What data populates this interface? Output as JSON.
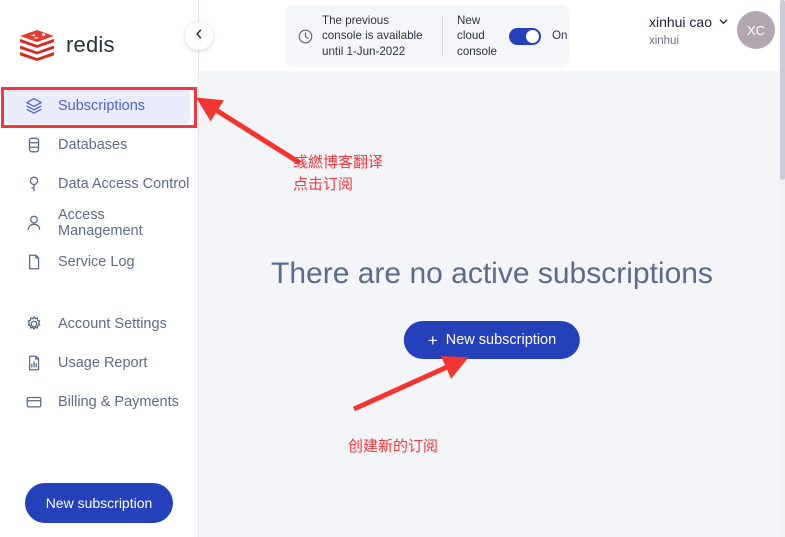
{
  "brand": {
    "name": "redis",
    "logo_icon": "redis-cube-logo"
  },
  "sidebar": {
    "collapse_icon": "chevron-left-icon",
    "groups": [
      {
        "items": [
          {
            "label": "Subscriptions",
            "icon": "layers-icon",
            "active": true
          },
          {
            "label": "Databases",
            "icon": "database-icon",
            "active": false
          },
          {
            "label": "Data Access Control",
            "icon": "key-icon",
            "active": false
          },
          {
            "label": "Access Management",
            "icon": "user-icon",
            "active": false
          },
          {
            "label": "Service Log",
            "icon": "document-icon",
            "active": false
          }
        ]
      },
      {
        "items": [
          {
            "label": "Account Settings",
            "icon": "gear-icon",
            "active": false
          },
          {
            "label": "Usage Report",
            "icon": "report-icon",
            "active": false
          },
          {
            "label": "Billing & Payments",
            "icon": "credit-card-icon",
            "active": false
          }
        ]
      }
    ],
    "cta_label": "New subscription"
  },
  "header": {
    "banner": {
      "icon": "clock-icon",
      "message": "The previous console is available until 1-Jun-2022",
      "toggle_label": "New cloud console",
      "toggle_state": "On",
      "toggle_on": true
    },
    "user": {
      "name": "xinhui cao",
      "org": "xinhui",
      "chevron_icon": "chevron-down-icon",
      "avatar_initials": "XC"
    }
  },
  "main": {
    "empty_title": "There are no active subscriptions",
    "new_subscription_button": "New subscription",
    "plus_icon": "plus-icon"
  },
  "annotations": {
    "top_line_1": "彧繎博客翻译",
    "top_line_2": "点击订阅",
    "bottom_text": "创建新的订阅",
    "color": "#f0393f"
  },
  "colors": {
    "accent_blue": "#2440bb",
    "active_nav_bg": "#e9edfb",
    "active_nav_text": "#4f62c9",
    "main_bg": "#f4f5f8",
    "title_text": "#5c6b8a",
    "annotation_red": "#f0393f",
    "avatar_bg": "#b3a6ae"
  }
}
